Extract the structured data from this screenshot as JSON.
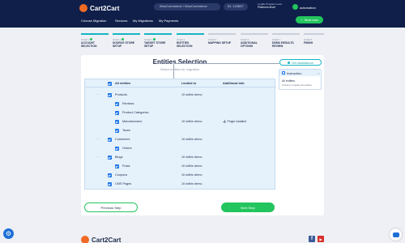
{
  "header": {
    "logo_text": "Cart2Cart",
    "source_target": "WooCommerce / WooCommerce",
    "migration_id_label": "ID: 123857",
    "balance_label": "Loyalty Program Level",
    "balance_value": "Platinum level",
    "user_name": "automation",
    "start_new_label": "Start new",
    "nav": [
      "Choose Migration",
      "Services",
      "My Migrations",
      "My Payments"
    ]
  },
  "steps": [
    {
      "num": "STEP 1",
      "name": "ACCOUNT SELECTION",
      "state": "done"
    },
    {
      "num": "STEP 2",
      "name": "SOURCE STORE SETUP",
      "state": "done"
    },
    {
      "num": "STEP 3",
      "name": "TARGET STORE SETUP",
      "state": "done"
    },
    {
      "num": "STEP 4",
      "name": "ENTITIES SELECTION",
      "state": "active"
    },
    {
      "num": "STEP 5",
      "name": "MAPPING SETUP",
      "state": "todo"
    },
    {
      "num": "STEP 6",
      "name": "ADDITIONAL OPTIONS",
      "state": "todo"
    },
    {
      "num": "STEP 7",
      "name": "DEMO RESULTS REVIEW",
      "state": "todo"
    },
    {
      "num": "STEP 8",
      "name": "FINISH",
      "state": "todo"
    }
  ],
  "main": {
    "title": "Entities Selection",
    "subtitle": "Select entities for migration"
  },
  "table": {
    "headers": [
      "All entities",
      "Limited to",
      "Additional info"
    ],
    "rows": [
      {
        "label": "Products",
        "limit": "10 within demo",
        "info": "",
        "level": 0,
        "expandable": true
      },
      {
        "label": "Reviews",
        "limit": "",
        "info": "",
        "level": 1,
        "expandable": false
      },
      {
        "label": "Product Categories",
        "limit": "",
        "info": "",
        "level": 1,
        "expandable": false
      },
      {
        "label": "Manufacturers",
        "limit": "10 within demo",
        "info": "Plugin installed",
        "level": 1,
        "expandable": false
      },
      {
        "label": "Taxes",
        "limit": "",
        "info": "",
        "level": 1,
        "expandable": false
      },
      {
        "label": "Customers",
        "limit": "10 within demo",
        "info": "",
        "level": 0,
        "expandable": true
      },
      {
        "label": "Orders",
        "limit": "",
        "info": "",
        "level": 1,
        "expandable": false
      },
      {
        "label": "Blogs",
        "limit": "10 within demo",
        "info": "",
        "level": 0,
        "expandable": true
      },
      {
        "label": "Posts",
        "limit": "10 within demo",
        "info": "",
        "level": 1,
        "expandable": false
      },
      {
        "label": "Coupons",
        "limit": "10 within demo",
        "info": "",
        "level": 0,
        "expandable": false
      },
      {
        "label": "CMS Pages",
        "limit": "10 within demo",
        "info": "",
        "level": 0,
        "expandable": false
      }
    ]
  },
  "buttons": {
    "previous": "Previous Step",
    "next": "Next Step",
    "assistance": "Get Assistance"
  },
  "instruction": {
    "title": "Instruction",
    "controls": "‹ ›",
    "line1": "All entities",
    "line2": "Check to migrate all entities"
  },
  "footer": {
    "logo_text": "Cart2Cart",
    "facebook": "f",
    "youtube": "▶"
  },
  "colors": {
    "header_bg": "#0f1f4a",
    "accent_green": "#23c55e",
    "accent_teal": "#16b5c4",
    "checkbox_blue": "#1973e8",
    "brand_orange": "#f36a24"
  }
}
